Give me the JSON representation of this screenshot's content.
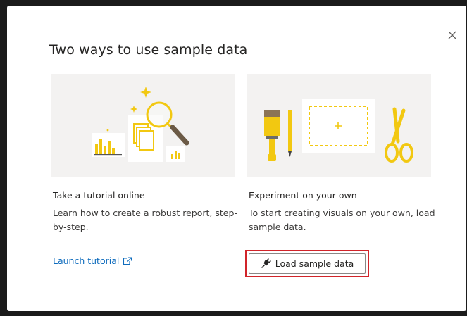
{
  "dialog": {
    "title": "Two ways to use sample data",
    "close_icon": "close-icon"
  },
  "cards": {
    "tutorial": {
      "title": "Take a tutorial online",
      "description": "Learn how to create a robust report, step-by-step.",
      "link_label": "Launch tutorial",
      "link_icon": "external-link-icon",
      "illustration": "tutorial-illustration"
    },
    "experiment": {
      "title": "Experiment on your own",
      "description": "To start creating visuals on your own, load sample data.",
      "button_label": "Load sample data",
      "button_icon": "plug-icon",
      "illustration": "experiment-illustration"
    }
  },
  "colors": {
    "accent_yellow": "#f2c811",
    "link_blue": "#0f6cbd",
    "highlight_red": "#d1242a",
    "card_bg": "#f3f2f1"
  }
}
